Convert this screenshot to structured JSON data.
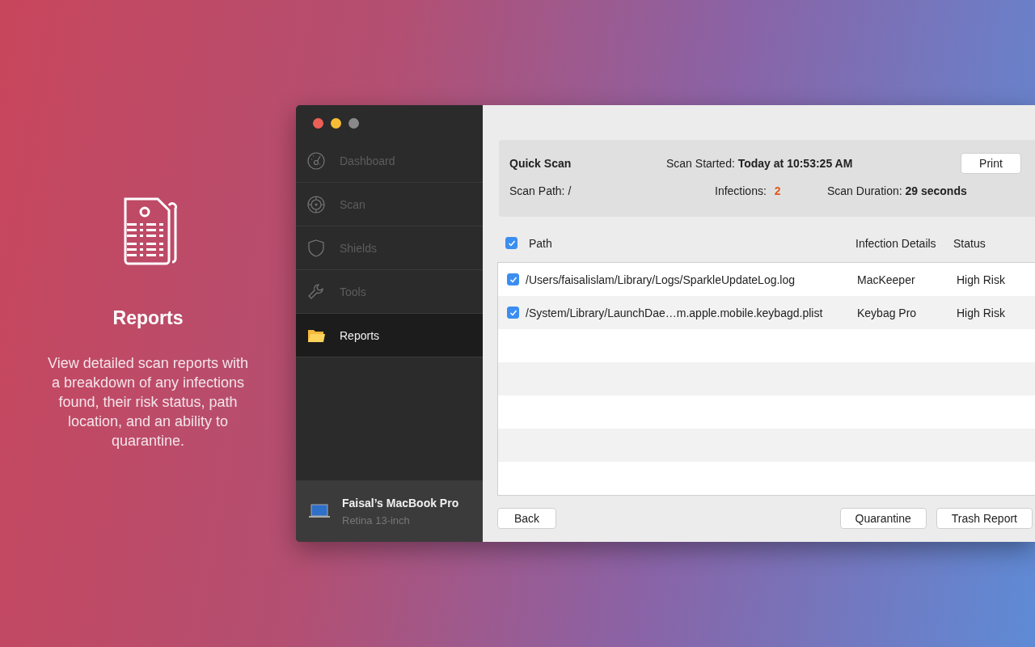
{
  "promo": {
    "title": "Reports",
    "description": "View detailed scan reports with a breakdown of any infections found, their risk status, path location, and an ability to quarantine."
  },
  "sidebar": {
    "items": [
      {
        "label": "Dashboard",
        "selected": false
      },
      {
        "label": "Scan",
        "selected": false
      },
      {
        "label": "Shields",
        "selected": false
      },
      {
        "label": "Tools",
        "selected": false
      },
      {
        "label": "Reports",
        "selected": true
      }
    ],
    "device": {
      "name": "Faisal’s MacBook Pro",
      "model": "Retina  13-inch"
    }
  },
  "summary": {
    "scan_type": "Quick Scan",
    "started_label": "Scan Started:",
    "started_value": "Today at 10:53:25 AM",
    "print_button": "Print",
    "path_label": "Scan Path:",
    "path_value": "/",
    "infections_label": "Infections:",
    "infections_value": "2",
    "duration_label": "Scan Duration:",
    "duration_value": "29 seconds"
  },
  "table": {
    "select_all": true,
    "columns": [
      "Path",
      "Infection Details",
      "Status"
    ],
    "rows": [
      {
        "checked": true,
        "path": "/Users/faisalislam/Library/Logs/SparkleUpdateLog.log",
        "details": "MacKeeper",
        "status": "High Risk"
      },
      {
        "checked": true,
        "path": "/System/Library/LaunchDae…m.apple.mobile.keybagd.plist",
        "details": "Keybag Pro",
        "status": "High Risk"
      }
    ]
  },
  "buttons": {
    "back": "Back",
    "quarantine": "Quarantine",
    "trash": "Trash Report"
  }
}
